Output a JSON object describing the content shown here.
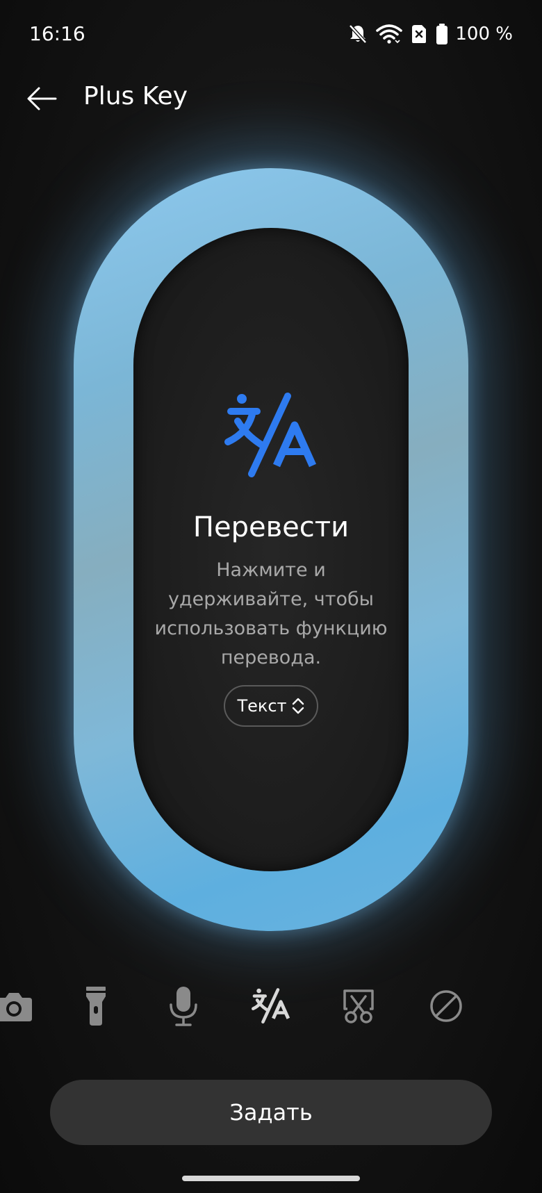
{
  "status_bar": {
    "time": "16:16",
    "battery": "100 %",
    "icons": [
      "bell-off-icon",
      "wifi-icon",
      "sim-off-icon",
      "battery-icon"
    ]
  },
  "header": {
    "back_icon": "arrow-left-icon",
    "title": "Plus Key"
  },
  "feature": {
    "icon": "translate-icon",
    "title": "Перевести",
    "description": "Нажмите и удерживайте, чтобы использовать функцию перевода.",
    "mode": {
      "selected": "Текст",
      "icon": "chevron-up-down-icon"
    }
  },
  "actions": {
    "items": [
      {
        "icon": "camera-icon",
        "selected": false
      },
      {
        "icon": "flashlight-icon",
        "selected": false
      },
      {
        "icon": "microphone-icon",
        "selected": false
      },
      {
        "icon": "translate-icon",
        "selected": true
      },
      {
        "icon": "screenshot-scissors-icon",
        "selected": false
      },
      {
        "icon": "block-icon",
        "selected": false
      }
    ]
  },
  "primary_button": {
    "label": "Задать"
  },
  "colors": {
    "accent_blue": "#2E7BF0",
    "ring_light": "#8EC9EE",
    "ring_deep": "#5EAFDF",
    "background": "#141414",
    "button_bg": "#333333"
  }
}
